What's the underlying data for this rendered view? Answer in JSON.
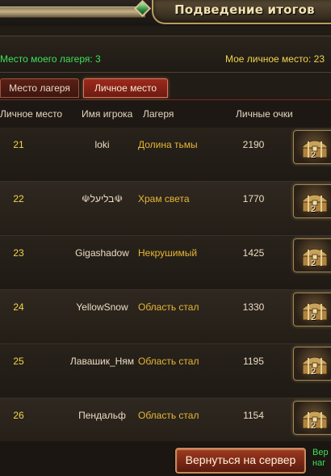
{
  "header": {
    "title": "Подведение итогов"
  },
  "info": {
    "camp_place_label": "Место моего лагеря: 3",
    "personal_place_label": "Мое личное место: 23"
  },
  "tabs": [
    {
      "label": "Место лагеря",
      "active": false
    },
    {
      "label": "Личное место",
      "active": true
    }
  ],
  "columns": {
    "personal_place": "Личное место",
    "player_name": "Имя игрока",
    "camp": "Лагеря",
    "personal_points": "Личные очки"
  },
  "rows": [
    {
      "rank": "21",
      "name": "loki",
      "camp": "Долина тьмы",
      "points": "2190",
      "reward_count": "2",
      "reward_icon": "treasure-chest-icon"
    },
    {
      "rank": "22",
      "name": "☫בליעל☫",
      "camp": "Храм света",
      "points": "1770",
      "reward_count": "2",
      "reward_icon": "treasure-chest-icon"
    },
    {
      "rank": "23",
      "name": "Gigashadow",
      "camp": "Некрушимый",
      "points": "1425",
      "reward_count": "2",
      "reward_icon": "treasure-chest-icon"
    },
    {
      "rank": "24",
      "name": "YellowSnow",
      "camp": "Область стал",
      "points": "1330",
      "reward_count": "2",
      "reward_icon": "treasure-chest-icon"
    },
    {
      "rank": "25",
      "name": "Лавашик_Ням",
      "camp": "Область стал",
      "points": "1195",
      "reward_count": "2",
      "reward_icon": "treasure-chest-icon"
    },
    {
      "rank": "26",
      "name": "Пендальф",
      "camp": "Область стал",
      "points": "1154",
      "reward_count": "2",
      "reward_icon": "treasure-chest-icon"
    }
  ],
  "footer": {
    "return_button": "Вернуться на сервер",
    "reward_note_line1": "Вер",
    "reward_note_line2": "наг"
  },
  "colors": {
    "green_text": "#3ee05a",
    "yellow_text": "#f3d64a",
    "camp_text": "#e7b636",
    "button_red": "#9f3a20"
  }
}
